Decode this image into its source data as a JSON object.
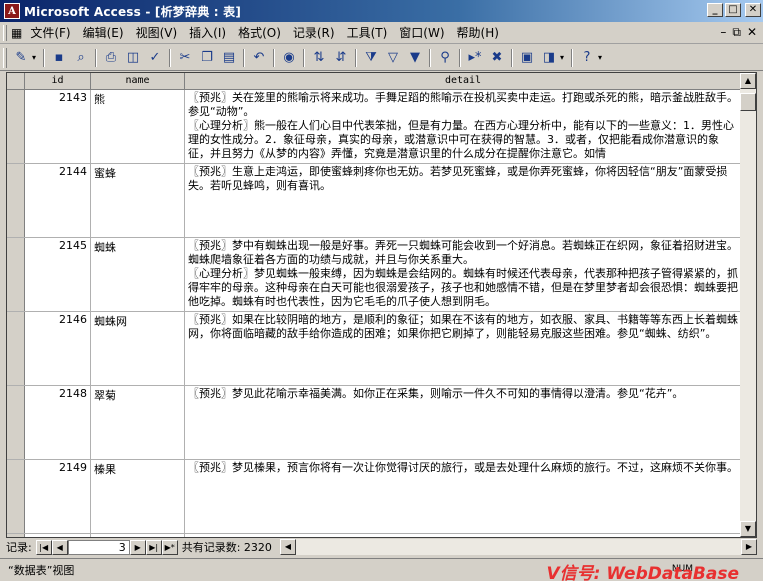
{
  "window": {
    "title": "Microsoft Access - [析梦辞典 : 表]",
    "app_icon_label": "A"
  },
  "menu": [
    {
      "label": "文件(F)"
    },
    {
      "label": "编辑(E)"
    },
    {
      "label": "视图(V)"
    },
    {
      "label": "插入(I)"
    },
    {
      "label": "格式(O)"
    },
    {
      "label": "记录(R)"
    },
    {
      "label": "工具(T)"
    },
    {
      "label": "窗口(W)"
    },
    {
      "label": "帮助(H)"
    }
  ],
  "toolbar_icons": [
    "view-icon",
    "save-icon",
    "search-icon",
    "print-icon",
    "print-preview-icon",
    "spelling-icon",
    "cut-icon",
    "copy-icon",
    "paste-icon",
    "undo-icon",
    "hyperlink-icon",
    "sort-ascending-icon",
    "sort-descending-icon",
    "filter-by-selection-icon",
    "filter-by-form-icon",
    "apply-filter-icon",
    "find-icon",
    "new-record-icon",
    "delete-record-icon",
    "database-window-icon",
    "new-object-icon",
    "help-icon"
  ],
  "columns": {
    "id": "id",
    "name": "name",
    "detail": "detail"
  },
  "rows": [
    {
      "id": "2143",
      "name": "熊",
      "detail": [
        "〖预兆〗关在笼里的熊喻示将来成功。手舞足蹈的熊喻示在投机买卖中走运。打跑或杀死的熊，暗示釜战胜敌手。参见“动物”。",
        "〖心理分析〗熊一般在人们心目中代表笨拙，但是有力量。在西方心理分析中，能有以下的一些意义：1．男性心理的女性成分。2．象征母亲，真实的母亲，或潜意识中可在获得的智慧。3．或者，仅把能看成你潜意识的象征，并且努力《从梦的内容》弄懂，究竟是潜意识里的什么成分在提醒你注意它。如情"
      ]
    },
    {
      "id": "2144",
      "name": "蜜蜂",
      "detail": [
        "〖预兆〗生意上走鸿运，即使蜜蜂刺疼你也无妨。若梦见死蜜蜂，或是你弄死蜜蜂，你将因轻信“朋友”面蒙受损失。若听见蜂鸣，则有喜讯。"
      ]
    },
    {
      "id": "2145",
      "name": "蜘蛛",
      "detail": [
        "〖预兆〗梦中有蜘蛛出现一般是好事。弄死一只蜘蛛可能会收到一个好消息。若蜘蛛正在织网，象征着招财进宝。蜘蛛爬墙象征着各方面的功绩与成就，并且与你关系重大。",
        "〖心理分析〗梦见蜘蛛一般束缚，因为蜘蛛是会结网的。蜘蛛有时候还代表母亲，代表那种把孩子管得紧紧的，抓得牢牢的母亲。这种母亲在白天可能也很溺爱孩子，孩子也和她感情不错，但是在梦里梦者却会很恐惧：蜘蛛要把他吃掉。蜘蛛有时也代表性，因为它毛毛的爪子使人想到阴毛。"
      ]
    },
    {
      "id": "2146",
      "name": "蜘蛛网",
      "detail": [
        "〖预兆〗如果在比较阴暗的地方，是顺利的象征；如果在不该有的地方，如衣服、家具、书籍等等东西上长着蜘蛛网，你将面临暗藏的敌手给你造成的困难；如果你把它刷掉了，则能轻易克服这些困难。参见“蜘蛛、纺织”。"
      ]
    },
    {
      "id": "2148",
      "name": "翠菊",
      "detail": [
        "〖预兆〗梦见此花喻示幸福美满。如你正在采集，则喻示一件久不可知的事情得以澄清。参见“花卉”。"
      ]
    },
    {
      "id": "2149",
      "name": "榛果",
      "detail": [
        "〖预兆〗梦见榛果，预言你将有一次让你觉得讨厌的旅行，或是去处理什么麻烦的旅行。不过，这麻烦不关你事。"
      ]
    },
    {
      "id": "",
      "name": "",
      "detail": []
    }
  ],
  "navigation": {
    "label": "记录:",
    "current": "3",
    "count_text": "共有记录数: 2320"
  },
  "status": {
    "view": "“数据表”视图",
    "indicator": "NUM",
    "watermark": "V信号: WebDataBase"
  }
}
